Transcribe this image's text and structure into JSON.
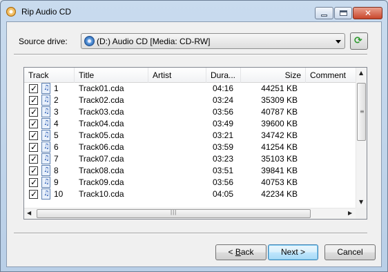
{
  "window": {
    "title": "Rip Audio CD"
  },
  "source": {
    "label": "Source drive:",
    "drive": "(D:) Audio CD [Media: CD-RW]"
  },
  "columns": {
    "track": "Track",
    "title": "Title",
    "artist": "Artist",
    "duration": "Dura...",
    "size": "Size",
    "comment": "Comment"
  },
  "tracks": [
    {
      "num": "1",
      "title": "Track01.cda",
      "duration": "04:16",
      "size": "44251 KB",
      "checked": true
    },
    {
      "num": "2",
      "title": "Track02.cda",
      "duration": "03:24",
      "size": "35309 KB",
      "checked": true
    },
    {
      "num": "3",
      "title": "Track03.cda",
      "duration": "03:56",
      "size": "40787 KB",
      "checked": true
    },
    {
      "num": "4",
      "title": "Track04.cda",
      "duration": "03:49",
      "size": "39600 KB",
      "checked": true
    },
    {
      "num": "5",
      "title": "Track05.cda",
      "duration": "03:21",
      "size": "34742 KB",
      "checked": true
    },
    {
      "num": "6",
      "title": "Track06.cda",
      "duration": "03:59",
      "size": "41254 KB",
      "checked": true
    },
    {
      "num": "7",
      "title": "Track07.cda",
      "duration": "03:23",
      "size": "35103 KB",
      "checked": true
    },
    {
      "num": "8",
      "title": "Track08.cda",
      "duration": "03:51",
      "size": "39841 KB",
      "checked": true
    },
    {
      "num": "9",
      "title": "Track09.cda",
      "duration": "03:56",
      "size": "40753 KB",
      "checked": true
    },
    {
      "num": "10",
      "title": "Track10.cda",
      "duration": "04:05",
      "size": "42234 KB",
      "checked": true
    }
  ],
  "buttons": {
    "back_prefix": "< ",
    "back_mnemonic": "B",
    "back_rest": "ack",
    "next": "Next >",
    "cancel": "Cancel"
  }
}
